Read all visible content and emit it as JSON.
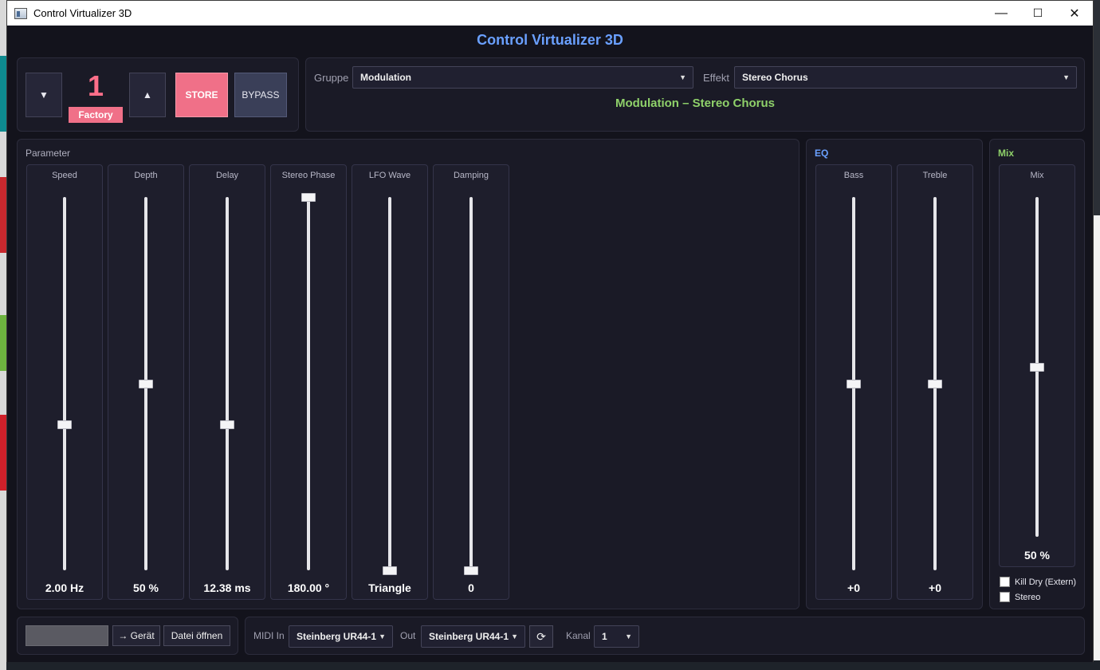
{
  "window": {
    "title": "Control Virtualizer 3D",
    "min": "—",
    "max": "☐",
    "close": "✕"
  },
  "app_title": "Control Virtualizer 3D",
  "preset": {
    "down_label": "▼",
    "up_label": "▲",
    "number": "1",
    "bank": "Factory",
    "store_label": "STORE",
    "bypass_label": "BYPASS"
  },
  "effect": {
    "group_label": "Gruppe",
    "group_value": "Modulation",
    "effect_label": "Effekt",
    "effect_value": "Stereo Chorus",
    "title": "Modulation – Stereo Chorus"
  },
  "parameter_section": {
    "title": "Parameter",
    "faders": [
      {
        "name": "Speed",
        "value": "2.00 Hz",
        "level": 0.39
      },
      {
        "name": "Depth",
        "value": "50 %",
        "level": 0.5
      },
      {
        "name": "Delay",
        "value": "12.38 ms",
        "level": 0.39
      },
      {
        "name": "Stereo Phase",
        "value": "180.00 °",
        "level": 1.0
      },
      {
        "name": "LFO Wave",
        "value": "Triangle",
        "level": 0.0
      },
      {
        "name": "Damping",
        "value": "0",
        "level": 0.0
      }
    ]
  },
  "eq_section": {
    "title": "EQ",
    "faders": [
      {
        "name": "Bass",
        "value": "+0",
        "level": 0.5
      },
      {
        "name": "Treble",
        "value": "+0",
        "level": 0.5
      }
    ]
  },
  "mix_section": {
    "title": "Mix",
    "fader": {
      "name": "Mix",
      "value": "50 %",
      "level": 0.5
    },
    "kill_dry_label": "Kill Dry (Extern)",
    "stereo_label": "Stereo"
  },
  "footer": {
    "to_device_label": "→ Gerät",
    "open_file_label": "Datei öffnen",
    "midi_in_label": "MIDI In",
    "midi_in_value": "Steinberg UR44-1",
    "out_label": "Out",
    "midi_out_value": "Steinberg UR44-1",
    "refresh_icon": "⟳",
    "channel_label": "Kanal",
    "channel_value": "1"
  },
  "colors": {
    "accent_blue": "#6aa0ff",
    "accent_green": "#8fd16a",
    "accent_pink": "#f07088",
    "background": "#13131c"
  }
}
